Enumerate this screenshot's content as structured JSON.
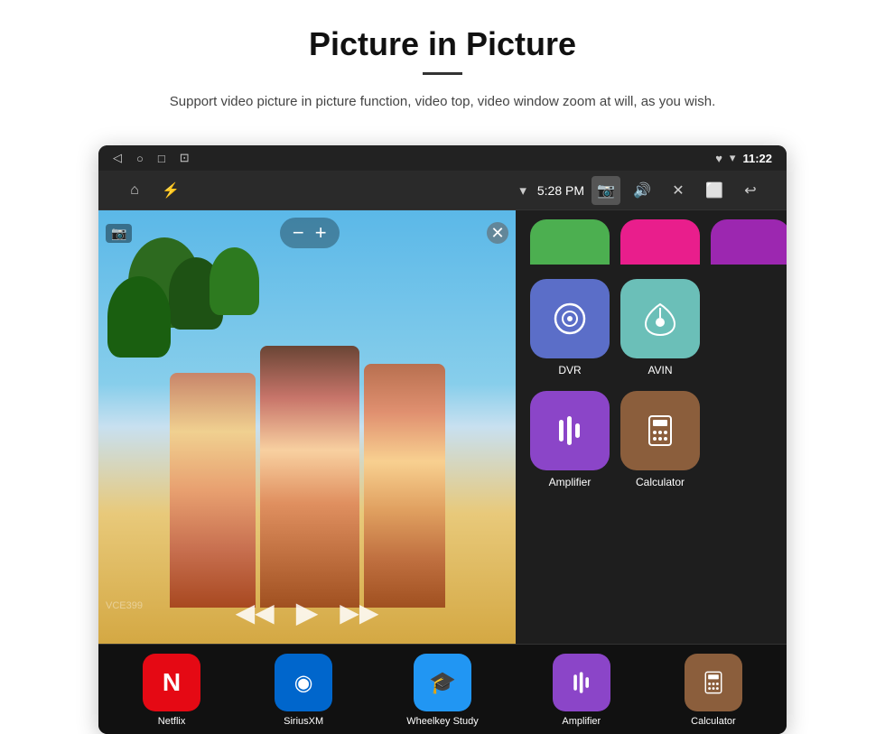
{
  "header": {
    "title": "Picture in Picture",
    "subtitle": "Support video picture in picture function, video top, video window zoom at will, as you wish.",
    "divider_visible": true
  },
  "status_bar": {
    "left_icons": [
      "◁",
      "○",
      "□",
      "⊡"
    ],
    "right_icons": [
      "♥ ▾",
      "11:22"
    ],
    "time": "11:22"
  },
  "nav_bar": {
    "home_icon": "⌂",
    "usb_icon": "⚡",
    "wifi_icon": "▾",
    "time": "5:28 PM",
    "camera_icon": "📷",
    "volume_icon": "🔊",
    "close_icon": "✕",
    "pip_icon": "⬜",
    "back_icon": "↩"
  },
  "pip_overlay": {
    "record_icon": "📷",
    "minus_label": "−",
    "plus_label": "+",
    "close_label": "✕",
    "prev_label": "◀◀",
    "play_label": "▶",
    "next_label": "▶▶"
  },
  "app_icons_top_partial": [
    {
      "color": "#4CAF50"
    },
    {
      "color": "#E91E8C"
    },
    {
      "color": "#9C27B0"
    }
  ],
  "app_icons_main": [
    {
      "id": "dvr",
      "label": "DVR",
      "bg_color": "#5b6ec8",
      "symbol": "◎"
    },
    {
      "id": "avin",
      "label": "AVIN",
      "bg_color": "#6bbfb8",
      "symbol": "⟠"
    },
    {
      "id": "amplifier",
      "label": "Amplifier",
      "bg_color": "#8b45c8",
      "symbol": "⊟"
    },
    {
      "id": "calculator",
      "label": "Calculator",
      "bg_color": "#8B5E3C",
      "symbol": "⊞"
    }
  ],
  "bottom_apps": [
    {
      "id": "netflix",
      "label": "Netflix",
      "bg_color": "#e50914",
      "symbol": "N"
    },
    {
      "id": "siriusxm",
      "label": "SiriusXM",
      "bg_color": "#0066cc",
      "symbol": "◉"
    },
    {
      "id": "wheelkey",
      "label": "Wheelkey Study",
      "bg_color": "#2196F3",
      "symbol": "🎓"
    },
    {
      "id": "amplifier",
      "label": "Amplifier",
      "bg_color": "#8b45c8",
      "symbol": "⊟"
    },
    {
      "id": "calculator",
      "label": "Calculator",
      "bg_color": "#8B5E3C",
      "symbol": "⊞"
    }
  ],
  "watermark": "VCE399"
}
